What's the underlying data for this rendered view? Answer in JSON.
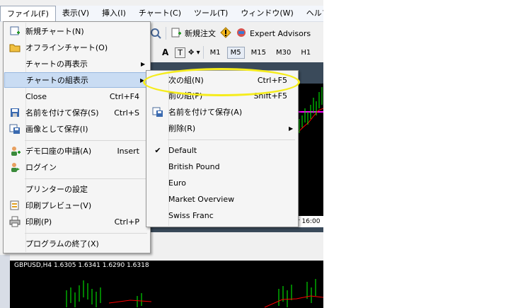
{
  "menubar": {
    "items": [
      {
        "label": "ファイル(F)"
      },
      {
        "label": "表示(V)"
      },
      {
        "label": "挿入(I)"
      },
      {
        "label": "チャート(C)"
      },
      {
        "label": "ツール(T)"
      },
      {
        "label": "ウィンドウ(W)"
      },
      {
        "label": "ヘルプ("
      }
    ]
  },
  "toolbar": {
    "new_order_label": "新規注文",
    "expert_advisors_label": "Expert Advisors",
    "a_label": "A",
    "t_label": "T",
    "timeframes": [
      "M1",
      "M5",
      "M15",
      "M30",
      "H1"
    ],
    "active_timeframe": "M5"
  },
  "file_menu": {
    "items": [
      {
        "label": "新規チャート(N)",
        "shortcut": "",
        "icon": "new-chart-icon"
      },
      {
        "label": "オフラインチャート(O)",
        "shortcut": "",
        "icon": "folder-icon"
      },
      {
        "label": "チャートの再表示",
        "shortcut": "",
        "icon": ""
      },
      {
        "label": "チャートの組表示",
        "shortcut": "",
        "icon": ""
      },
      {
        "label": "Close",
        "shortcut": "Ctrl+F4",
        "icon": ""
      },
      {
        "label": "名前を付けて保存(S)",
        "shortcut": "Ctrl+S",
        "icon": "save-icon"
      },
      {
        "label": "画像として保存(I)",
        "shortcut": "",
        "icon": "save-picture-icon"
      },
      {
        "label": "デモ口座の申請(A)",
        "shortcut": "Insert",
        "icon": "demo-account-icon"
      },
      {
        "label": "ログイン",
        "shortcut": "",
        "icon": "login-icon"
      },
      {
        "label": "プリンターの設定",
        "shortcut": "",
        "icon": ""
      },
      {
        "label": "印刷プレビュー(V)",
        "shortcut": "",
        "icon": "print-preview-icon"
      },
      {
        "label": "印刷(P)",
        "shortcut": "Ctrl+P",
        "icon": "print-icon"
      },
      {
        "label": "プログラムの終了(X)",
        "shortcut": "",
        "icon": ""
      }
    ]
  },
  "profiles_menu": {
    "next_label": "次の組(N)",
    "next_shortcut": "Ctrl+F5",
    "prev_label": "前の組(P)",
    "prev_shortcut": "Shift+F5",
    "save_as_label": "名前を付けて保存(A)",
    "delete_label": "削除(R)",
    "profiles": [
      "Default",
      "British Pound",
      "Euro",
      "Market Overview",
      "Swiss Franc"
    ],
    "checked_profile": "Default"
  },
  "chart": {
    "time_label": "r 16:00",
    "bottom_title": "GBPUSD,H4  1.6305 1.6341 1.6290 1.6318"
  },
  "colors": {
    "highlight_ring": "#f5ec1d",
    "menu_highlight": "#c9dcf3",
    "candle_green": "#00ff00",
    "ma_red": "#ff0000",
    "magenta_line": "#ff00ff"
  }
}
